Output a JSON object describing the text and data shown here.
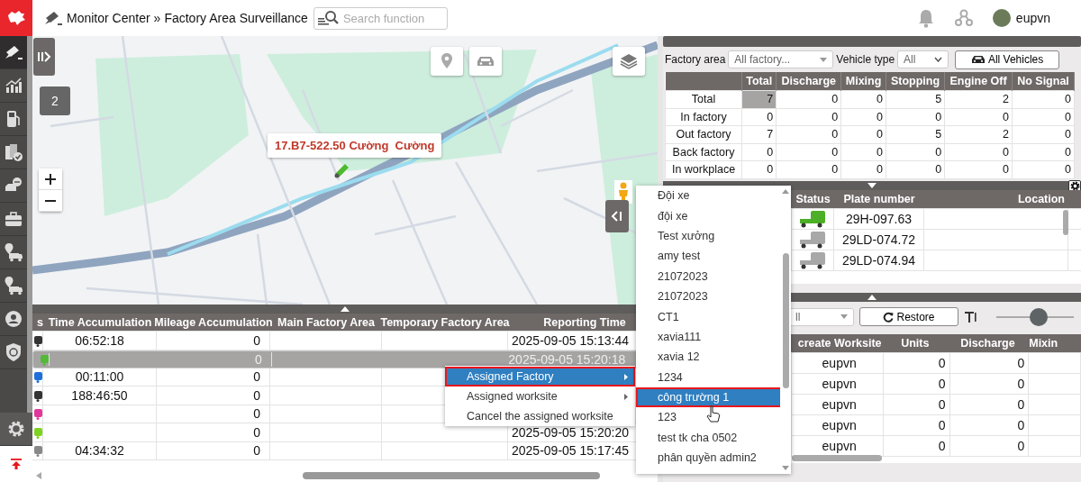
{
  "header": {
    "breadcrumb": [
      "Monitor Center",
      "»",
      "Factory Area Surveillance"
    ],
    "search": {
      "placeholder": "Search function"
    },
    "user": "eupvn"
  },
  "sidebar": {
    "items": [
      {
        "kind": "camera",
        "selected": true
      },
      {
        "kind": "chart",
        "selected": false
      },
      {
        "kind": "fuel",
        "selected": false
      },
      {
        "kind": "doc-check",
        "selected": false
      },
      {
        "kind": "car-chat",
        "selected": false
      },
      {
        "kind": "briefcase",
        "selected": false
      },
      {
        "kind": "truck-pin",
        "selected": false
      },
      {
        "kind": "truck-pin",
        "selected": false
      },
      {
        "kind": "person-circle",
        "selected": false
      },
      {
        "kind": "shield",
        "selected": false
      }
    ]
  },
  "map": {
    "cluster": "2",
    "popup": "17.B7-522.50 Cường  Cường"
  },
  "vehicle_table": {
    "columns": [
      "s",
      "Time Accumulation",
      "Mileage Accumulation",
      "Main Factory Area",
      "Temporary Factory Area",
      "Reporting Time"
    ],
    "rows": [
      {
        "color": "#333333",
        "selected": false,
        "time_accumulation": "06:52:18",
        "mileage_accumulation": "0",
        "reporting_time": "2025-09-05 15:13:44"
      },
      {
        "color": "#55b83a",
        "selected": true,
        "mileage_accumulation": "0",
        "reporting_time": "2025-09-05 15:20:18"
      },
      {
        "color": "#1e6fd9",
        "selected": false,
        "time_accumulation": "00:11:00",
        "mileage_accumulation": "0"
      },
      {
        "color": "#333333",
        "selected": false,
        "time_accumulation": "188:46:50",
        "mileage_accumulation": "0"
      },
      {
        "color": "#e0389a",
        "selected": false,
        "mileage_accumulation": "0"
      },
      {
        "color": "#7ed321",
        "selected": false,
        "mileage_accumulation": "0",
        "reporting_time": "2025-09-05 15:20:20"
      },
      {
        "color": "#888888",
        "selected": false,
        "time_accumulation": "04:34:32",
        "mileage_accumulation": "0",
        "reporting_time": "2025-09-05 15:17:45"
      }
    ]
  },
  "context_menu": {
    "items": [
      {
        "label": "Assigned Factory",
        "selected": true,
        "submenu": true
      },
      {
        "label": "Assigned worksite",
        "selected": false,
        "submenu": true
      },
      {
        "label": "Cancel the assigned worksite",
        "selected": false,
        "submenu": false
      }
    ]
  },
  "submenu": {
    "items": [
      {
        "label": "Đội xe",
        "selected": false
      },
      {
        "label": "đội xe",
        "selected": false
      },
      {
        "label": "Test xưởng",
        "selected": false
      },
      {
        "label": "amy test",
        "selected": false
      },
      {
        "label": "21072023",
        "selected": false
      },
      {
        "label": "21072023",
        "selected": false
      },
      {
        "label": "CT1",
        "selected": false
      },
      {
        "label": "xavia111",
        "selected": false
      },
      {
        "label": "xavia 12",
        "selected": false
      },
      {
        "label": "1234",
        "selected": false
      },
      {
        "label": "công trường 1",
        "selected": true
      },
      {
        "label": "123",
        "selected": false
      },
      {
        "label": "test tk cha 0502",
        "selected": false
      },
      {
        "label": "phân quyền admin2",
        "selected": false
      }
    ]
  },
  "right_panel": {
    "filters": {
      "factory_area": {
        "label": "Factory area",
        "value": "All factory..."
      },
      "vehicle_type": {
        "label": "Vehicle type",
        "value": "All"
      },
      "all_vehicles_button": "All Vehicles"
    },
    "stats": {
      "columns": [
        "Total",
        "Discharge",
        "Mixing",
        "Stopping",
        "Engine Off",
        "No Signal"
      ],
      "rows": [
        {
          "label": "Total",
          "highlighted": true,
          "values": [
            "7",
            "0",
            "0",
            "5",
            "2",
            "0"
          ]
        },
        {
          "label": "In factory",
          "highlighted": false,
          "values": [
            "0",
            "0",
            "0",
            "0",
            "0",
            "0"
          ]
        },
        {
          "label": "Out factory",
          "highlighted": false,
          "values": [
            "7",
            "0",
            "0",
            "5",
            "2",
            "0"
          ]
        },
        {
          "label": "Back factory",
          "highlighted": false,
          "values": [
            "0",
            "0",
            "0",
            "0",
            "0",
            "0"
          ]
        },
        {
          "label": "In workplace",
          "highlighted": false,
          "values": [
            "0",
            "0",
            "0",
            "0",
            "0",
            "0"
          ]
        }
      ]
    },
    "vehicles": {
      "columns": [
        "Status",
        "Plate number",
        "Location"
      ],
      "rows": [
        {
          "color": "#4caf27",
          "plate": "29H-097.63"
        },
        {
          "color": "#a8a8a8",
          "plate": "29LD-074.72"
        },
        {
          "color": "#a8a8a8",
          "plate": "29LD-074.94"
        }
      ]
    },
    "worksites": {
      "select": "ll",
      "restore_button": "Restore",
      "font_slider": {
        "level": 0.55
      },
      "columns": [
        "create Worksite",
        "Units",
        "Discharge",
        "Mixin"
      ],
      "rows": [
        {
          "cells": [
            "eupvn",
            "0",
            "0"
          ]
        },
        {
          "cells": [
            "eupvn",
            "0",
            "0"
          ]
        },
        {
          "cells": [
            "eupvn",
            "0",
            "0"
          ]
        },
        {
          "cells": [
            "eupvn",
            "0",
            "0"
          ]
        },
        {
          "cells": [
            "eupvn",
            "0",
            "0"
          ]
        }
      ]
    }
  }
}
